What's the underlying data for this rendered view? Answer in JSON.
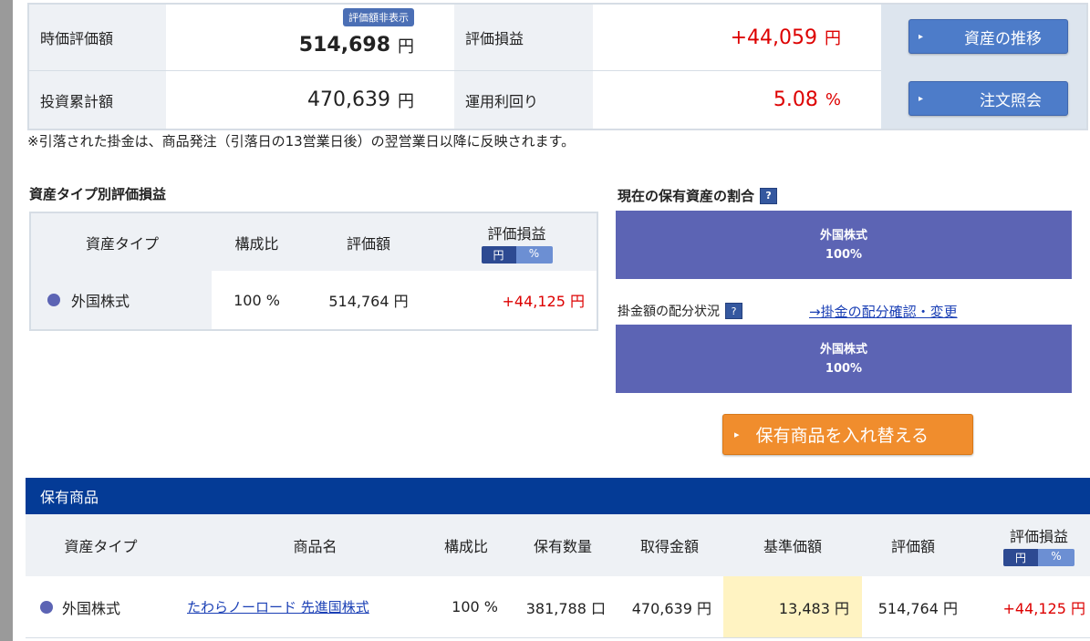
{
  "summary": {
    "market_value_label": "時価評価額",
    "hidden_badge": "評価額非表示",
    "market_value": "514,698",
    "yen": "円",
    "unrealized_label": "評価損益",
    "unrealized_value": "+44,059",
    "invested_label": "投資累計額",
    "invested_value": "470,639",
    "yield_label": "運用利回り",
    "yield_value": "5.08",
    "percent": "%",
    "btn_history": "資産の推移",
    "btn_orders": "注文照会"
  },
  "note": "※引落された掛金は、商品発注（引落日の13営業日後）の翌営業日以降に反映されます。",
  "asset_section": {
    "title": "資産タイプ別評価損益",
    "headers": [
      "資産タイプ",
      "構成比",
      "評価額",
      "評価損益"
    ],
    "toggle": [
      "円",
      "%"
    ],
    "rows": [
      {
        "type": "外国株式",
        "ratio": "100 %",
        "value": "514,764 円",
        "gain": "+44,125 円"
      }
    ]
  },
  "allocation": {
    "current_title": "現在の保有資産の割合",
    "current_bar": {
      "label": "外国株式",
      "pct": "100%"
    },
    "contrib_title": "掛金額の配分状況",
    "contrib_link": "→掛金の配分確認・変更",
    "contrib_bar": {
      "label": "外国株式",
      "pct": "100%"
    },
    "swap_button": "保有商品を入れ替える"
  },
  "holdings": {
    "title": "保有商品",
    "headers": [
      "資産タイプ",
      "商品名",
      "構成比",
      "保有数量",
      "取得金額",
      "基準価額",
      "評価額",
      "評価損益"
    ],
    "toggle": [
      "円",
      "%"
    ],
    "rows": [
      {
        "type": "外国株式",
        "name": "たわらノーロード 先進国株式",
        "ratio": "100 %",
        "qty": "381,788 口",
        "cost": "470,639 円",
        "nav": "13,483 円",
        "value": "514,764 円",
        "gain": "+44,125 円"
      }
    ]
  },
  "colors": {
    "accent": "#043b96",
    "gain": "#dd0000",
    "orange": "#f08d2d",
    "bar": "#5c64b4"
  }
}
